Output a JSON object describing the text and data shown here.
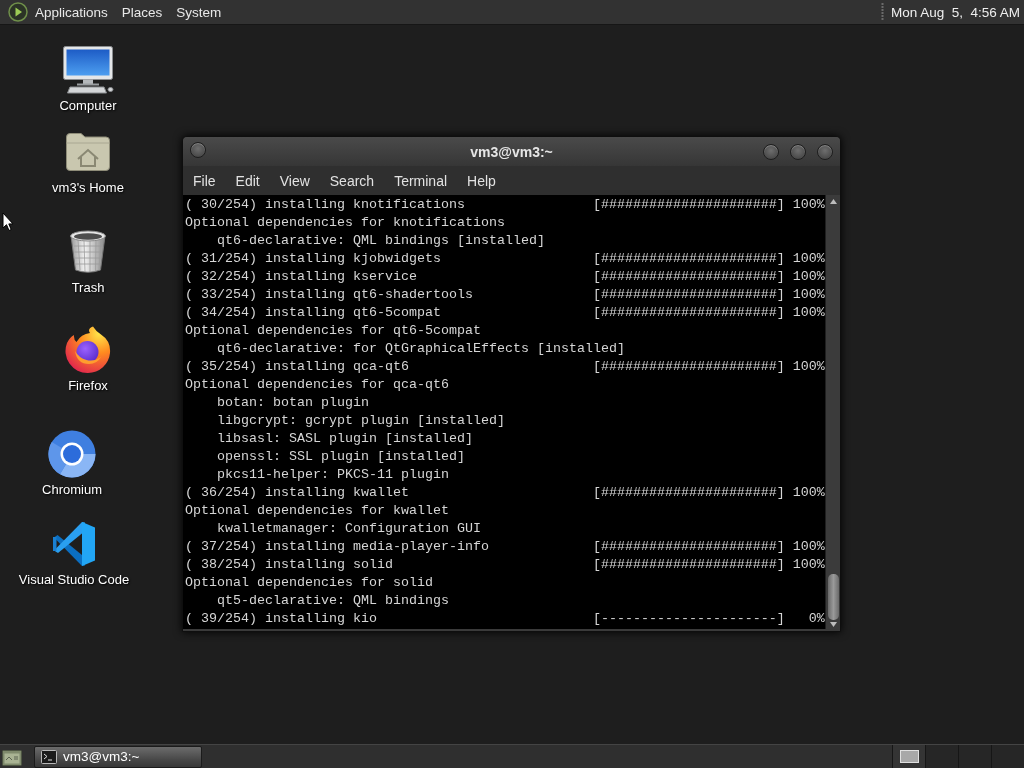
{
  "top_panel": {
    "menus": [
      "Applications",
      "Places",
      "System"
    ],
    "clock": "Mon Aug  5,  4:56 AM"
  },
  "desktop_icons": [
    {
      "label": "Computer",
      "kind": "computer"
    },
    {
      "label": "vm3's Home",
      "kind": "home"
    },
    {
      "label": "Trash",
      "kind": "trash"
    },
    {
      "label": "Firefox",
      "kind": "firefox"
    },
    {
      "label": "Chromium",
      "kind": "chromium"
    },
    {
      "label": "Visual Studio Code",
      "kind": "vscode"
    }
  ],
  "terminal": {
    "title": "vm3@vm3:~",
    "menu": [
      "File",
      "Edit",
      "View",
      "Search",
      "Terminal",
      "Help"
    ],
    "lines": [
      {
        "kind": "progress",
        "text": "( 30/254) installing knotifications",
        "bar": "[######################]",
        "percent": "100%"
      },
      {
        "kind": "note",
        "text": "Optional dependencies for knotifications"
      },
      {
        "kind": "dependency",
        "text": "qt6-declarative: QML bindings [installed]"
      },
      {
        "kind": "progress",
        "text": "( 31/254) installing kjobwidgets",
        "bar": "[######################]",
        "percent": "100%"
      },
      {
        "kind": "progress",
        "text": "( 32/254) installing kservice",
        "bar": "[######################]",
        "percent": "100%"
      },
      {
        "kind": "progress",
        "text": "( 33/254) installing qt6-shadertools",
        "bar": "[######################]",
        "percent": "100%"
      },
      {
        "kind": "progress",
        "text": "( 34/254) installing qt6-5compat",
        "bar": "[######################]",
        "percent": "100%"
      },
      {
        "kind": "note",
        "text": "Optional dependencies for qt6-5compat"
      },
      {
        "kind": "dependency",
        "text": "qt6-declarative: for QtGraphicalEffects [installed]"
      },
      {
        "kind": "progress",
        "text": "( 35/254) installing qca-qt6",
        "bar": "[######################]",
        "percent": "100%"
      },
      {
        "kind": "note",
        "text": "Optional dependencies for qca-qt6"
      },
      {
        "kind": "dependency",
        "text": "botan: botan plugin"
      },
      {
        "kind": "dependency",
        "text": "libgcrypt: gcrypt plugin [installed]"
      },
      {
        "kind": "dependency",
        "text": "libsasl: SASL plugin [installed]"
      },
      {
        "kind": "dependency",
        "text": "openssl: SSL plugin [installed]"
      },
      {
        "kind": "dependency",
        "text": "pkcs11-helper: PKCS-11 plugin"
      },
      {
        "kind": "progress",
        "text": "( 36/254) installing kwallet",
        "bar": "[######################]",
        "percent": "100%"
      },
      {
        "kind": "note",
        "text": "Optional dependencies for kwallet"
      },
      {
        "kind": "dependency",
        "text": "kwalletmanager: Configuration GUI"
      },
      {
        "kind": "progress",
        "text": "( 37/254) installing media-player-info",
        "bar": "[######################]",
        "percent": "100%"
      },
      {
        "kind": "progress",
        "text": "( 38/254) installing solid",
        "bar": "[######################]",
        "percent": "100%"
      },
      {
        "kind": "note",
        "text": "Optional dependencies for solid"
      },
      {
        "kind": "dependency",
        "text": "qt5-declarative: QML bindings"
      },
      {
        "kind": "progress",
        "text": "( 39/254) installing kio",
        "bar": "[----------------------]",
        "percent": "0%"
      }
    ]
  },
  "taskbar": {
    "windows": [
      {
        "title": "vm3@vm3:~",
        "selected": true
      }
    ],
    "workspaces": [
      {
        "selected": true
      },
      {
        "selected": false
      },
      {
        "selected": false
      },
      {
        "selected": false
      }
    ]
  }
}
